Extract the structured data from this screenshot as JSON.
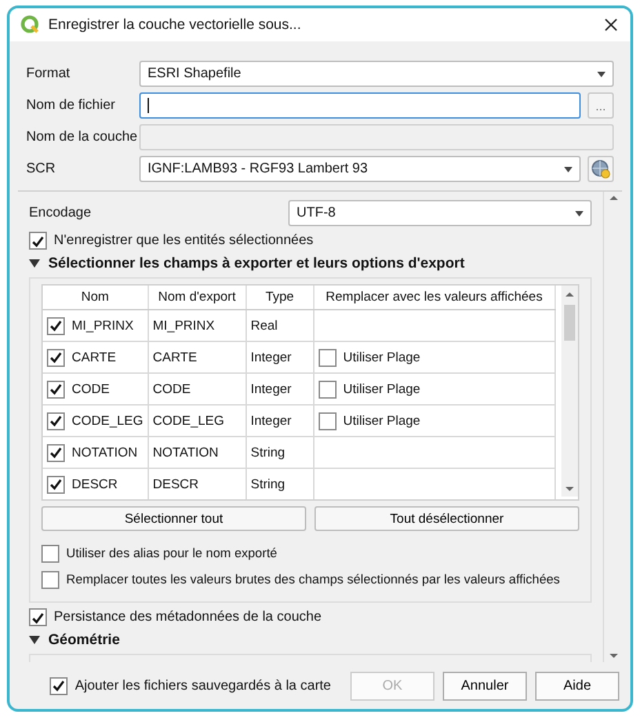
{
  "window": {
    "title": "Enregistrer la couche vectorielle sous..."
  },
  "form": [
    {
      "kind": "combo",
      "label": "Format",
      "value": "ESRI Shapefile"
    },
    {
      "kind": "file",
      "label": "Nom de fichier",
      "focused": true,
      "browse": "..."
    },
    {
      "kind": "text",
      "label": "Nom de la couche",
      "disabled": true
    },
    {
      "kind": "crs",
      "label": "SCR",
      "value": "IGNF:LAMB93 - RGF93 Lambert 93"
    }
  ],
  "encoding": {
    "label": "Encodage",
    "value": "UTF-8"
  },
  "only_selected": {
    "label": "N'enregistrer que les entités sélectionnées",
    "checked": true
  },
  "fields_section": {
    "title": "Sélectionner les champs à exporter et leurs options d'export",
    "expanded": true,
    "columns": [
      "Nom",
      "Nom d'export",
      "Type",
      "Remplacer avec les valeurs affichées"
    ],
    "rows": [
      {
        "checked": true,
        "name": "MI_PRINX",
        "export_name": "MI_PRINX",
        "type": "Real"
      },
      {
        "checked": true,
        "name": "CARTE",
        "export_name": "CARTE",
        "type": "Integer",
        "use_range": {
          "label": "Utiliser Plage",
          "checked": false
        }
      },
      {
        "checked": true,
        "name": "CODE",
        "export_name": "CODE",
        "type": "Integer",
        "use_range": {
          "label": "Utiliser Plage",
          "checked": false
        }
      },
      {
        "checked": true,
        "name": "CODE_LEG",
        "export_name": "CODE_LEG",
        "type": "Integer",
        "use_range": {
          "label": "Utiliser Plage",
          "checked": false
        }
      },
      {
        "checked": true,
        "name": "NOTATION",
        "export_name": "NOTATION",
        "type": "String"
      },
      {
        "checked": true,
        "name": "DESCR",
        "export_name": "DESCR",
        "type": "String"
      }
    ],
    "buttons": [
      "Sélectionner tout",
      "Tout désélectionner"
    ],
    "options": [
      {
        "label": "Utiliser des alias pour le nom exporté",
        "checked": false
      },
      {
        "label": "Remplacer toutes les valeurs brutes des champs sélectionnés par les valeurs affichées",
        "checked": false
      }
    ]
  },
  "persist": {
    "label": "Persistance des métadonnées de la couche",
    "checked": true
  },
  "geometry_section": {
    "title": "Géométrie",
    "expanded": true
  },
  "footer": {
    "add_to_map": {
      "label": "Ajouter les fichiers sauvegardés à la carte",
      "checked": true
    },
    "buttons": [
      {
        "label": "OK",
        "disabled": true
      },
      {
        "label": "Annuler",
        "disabled": false
      },
      {
        "label": "Aide",
        "disabled": false
      }
    ]
  }
}
